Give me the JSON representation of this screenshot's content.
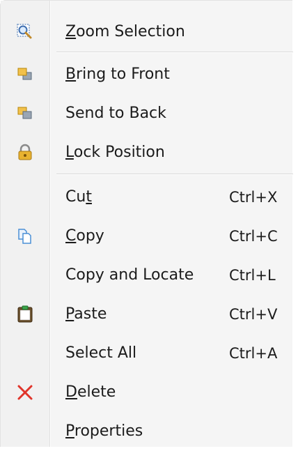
{
  "menu": {
    "items": [
      {
        "id": "zoom-selection",
        "pre": "",
        "u": "Z",
        "post": "oom Selection",
        "shortcut": "",
        "icon": "zoom-selection-icon"
      },
      {
        "id": "bring-to-front",
        "pre": "",
        "u": "B",
        "post": "ring to Front",
        "shortcut": "",
        "icon": "bring-to-front-icon"
      },
      {
        "id": "send-to-back",
        "pre": "Send to Back",
        "u": "",
        "post": "",
        "shortcut": "",
        "icon": "send-to-back-icon"
      },
      {
        "id": "lock-position",
        "pre": "",
        "u": "L",
        "post": "ock Position",
        "shortcut": "",
        "icon": "lock-icon"
      },
      {
        "id": "cut",
        "pre": "Cu",
        "u": "t",
        "post": "",
        "shortcut": "Ctrl+X",
        "icon": ""
      },
      {
        "id": "copy",
        "pre": "",
        "u": "C",
        "post": "opy",
        "shortcut": "Ctrl+C",
        "icon": "copy-icon"
      },
      {
        "id": "copy-and-locate",
        "pre": "Copy and Locate",
        "u": "",
        "post": "",
        "shortcut": "Ctrl+L",
        "icon": ""
      },
      {
        "id": "paste",
        "pre": "",
        "u": "P",
        "post": "aste",
        "shortcut": "Ctrl+V",
        "icon": "paste-icon"
      },
      {
        "id": "select-all",
        "pre": "Select All",
        "u": "",
        "post": "",
        "shortcut": "Ctrl+A",
        "icon": ""
      },
      {
        "id": "delete",
        "pre": "",
        "u": "D",
        "post": "elete",
        "shortcut": "",
        "icon": "delete-icon"
      },
      {
        "id": "properties",
        "pre": "",
        "u": "P",
        "post": "roperties",
        "shortcut": "",
        "icon": ""
      }
    ]
  },
  "colors": {
    "delete_x": "#e0342a",
    "lock_gold": "#d9a21c",
    "copy_blue": "#4a8fd6",
    "paste_green": "#3aa34a"
  }
}
